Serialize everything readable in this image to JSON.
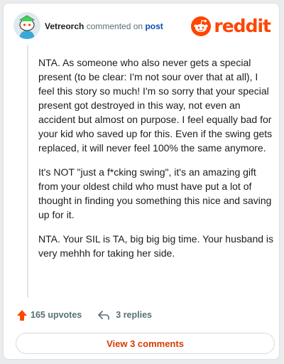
{
  "comment": {
    "username": "Vetreorch",
    "action_text": "commented on",
    "post_link_text": "post",
    "paragraphs": [
      "NTA. As someone who also never gets a special present (to be clear: I'm not sour over that at all), I feel this story so much! I'm so sorry that your special present got destroyed in this way, not even an accident but almost on purpose. I feel equally bad for your kid who saved up for this. Even if the swing gets replaced, it will never feel 100% the same anymore.",
      "It's NOT \"just a f*cking swing\", it's an amazing gift from your oldest child who must have put a lot of thought in finding you something this nice and saving up for it.",
      "NTA. Your SIL is TA, big big big time. Your husband is very mehhh for taking her side."
    ],
    "upvotes_text": "165 upvotes",
    "replies_text": "3 replies",
    "view_comments_label": "View 3 comments"
  },
  "brand": {
    "logo_text": "reddit",
    "accent_color": "#ff4500",
    "link_color": "#0a48b0"
  },
  "icons": {
    "avatar": "snoo-avatar-icon",
    "logo": "reddit-alien-icon",
    "upvote": "upvote-arrow-icon",
    "reply": "reply-arrow-icon"
  }
}
